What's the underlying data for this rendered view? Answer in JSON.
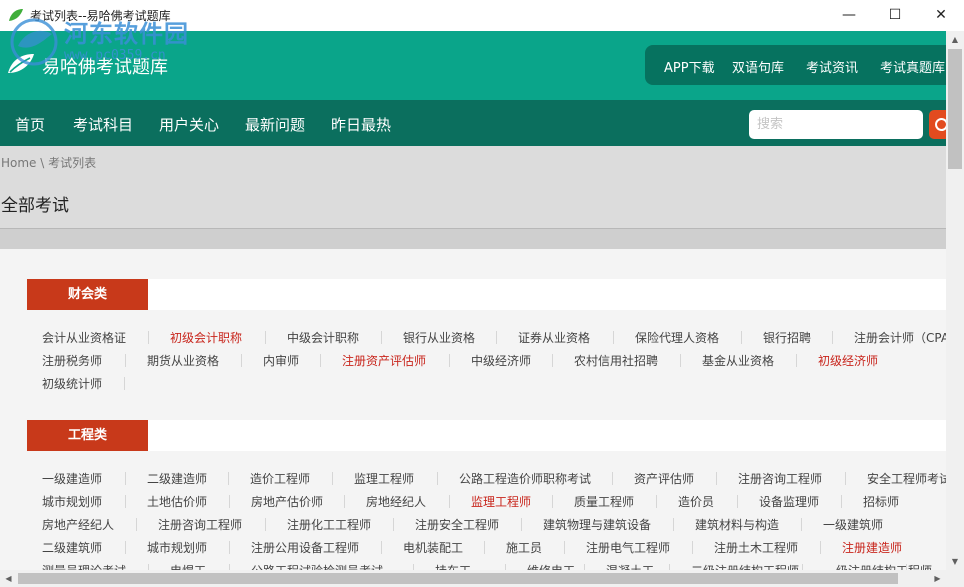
{
  "window": {
    "title": "考试列表--易哈佛考试题库",
    "minimize": "—",
    "maximize": "☐",
    "close": "✕"
  },
  "watermark": {
    "text": "河东软件园",
    "url": "www.pc0359.cn"
  },
  "header": {
    "site_name": "易哈佛考试题库",
    "top_links": [
      "APP下载",
      "双语句库",
      "考试资讯",
      "考试真题库"
    ]
  },
  "nav": {
    "items": [
      "首页",
      "考试科目",
      "用户关心",
      "最新问题",
      "昨日最热"
    ],
    "search_placeholder": "搜索"
  },
  "breadcrumb": "Home \\ 考试列表",
  "page_title": "全部考试",
  "colors": {
    "header": "#0aa58a",
    "nav": "#0b6f5e",
    "category": "#c8391a",
    "highlight_text": "#c8251c"
  },
  "categories": [
    {
      "label": "财会类",
      "rows": [
        [
          {
            "name": "会计从业资格证",
            "hot": false
          },
          {
            "name": "初级会计职称",
            "hot": true
          },
          {
            "name": "中级会计职称",
            "hot": false
          },
          {
            "name": "银行从业资格",
            "hot": false
          },
          {
            "name": "证券从业资格",
            "hot": false
          },
          {
            "name": "保险代理人资格",
            "hot": false
          },
          {
            "name": "银行招聘",
            "hot": false
          },
          {
            "name": "注册会计师（CPA）",
            "hot": false
          }
        ],
        [
          {
            "name": "注册税务师",
            "hot": false
          },
          {
            "name": "期货从业资格",
            "hot": false
          },
          {
            "name": "内审师",
            "hot": false
          },
          {
            "name": "注册资产评估师",
            "hot": true
          },
          {
            "name": "中级经济师",
            "hot": false
          },
          {
            "name": "农村信用社招聘",
            "hot": false
          },
          {
            "name": "基金从业资格",
            "hot": false
          },
          {
            "name": "初级经济师",
            "hot": true
          }
        ],
        [
          {
            "name": "初级统计师",
            "hot": false
          }
        ]
      ]
    },
    {
      "label": "工程类",
      "rows": [
        [
          {
            "name": "一级建造师",
            "hot": false
          },
          {
            "name": "二级建造师",
            "hot": false
          },
          {
            "name": "造价工程师",
            "hot": false
          },
          {
            "name": "监理工程师",
            "hot": false
          },
          {
            "name": "公路工程造价师职称考试",
            "hot": false
          },
          {
            "name": "资产评估师",
            "hot": false
          },
          {
            "name": "注册咨询工程师",
            "hot": false
          },
          {
            "name": "安全工程师考试",
            "hot": false
          }
        ],
        [
          {
            "name": "城市规划师",
            "hot": false
          },
          {
            "name": "土地估价师",
            "hot": false
          },
          {
            "name": "房地产估价师",
            "hot": false
          },
          {
            "name": "房地经纪人",
            "hot": false
          },
          {
            "name": "监理工程师",
            "hot": true
          },
          {
            "name": "质量工程师",
            "hot": false
          },
          {
            "name": "造价员",
            "hot": false
          },
          {
            "name": "设备监理师",
            "hot": false
          },
          {
            "name": "招标师",
            "hot": false
          }
        ],
        [
          {
            "name": "房地产经纪人",
            "hot": false
          },
          {
            "name": "注册咨询工程师",
            "hot": false
          },
          {
            "name": "注册化工工程师",
            "hot": false
          },
          {
            "name": "注册安全工程师",
            "hot": false
          },
          {
            "name": "建筑物理与建筑设备",
            "hot": false
          },
          {
            "name": "建筑材料与构造",
            "hot": false
          },
          {
            "name": "一级建筑师",
            "hot": false
          }
        ],
        [
          {
            "name": "二级建筑师",
            "hot": false
          },
          {
            "name": "城市规划师",
            "hot": false
          },
          {
            "name": "注册公用设备工程师",
            "hot": false
          },
          {
            "name": "电机装配工",
            "hot": false
          },
          {
            "name": "施工员",
            "hot": false
          },
          {
            "name": "注册电气工程师",
            "hot": false
          },
          {
            "name": "注册土木工程师",
            "hot": false
          },
          {
            "name": "注册建造师",
            "hot": true
          }
        ],
        [
          {
            "name": "测量员理论考试",
            "hot": false
          },
          {
            "name": "电焊工",
            "hot": false
          },
          {
            "name": "公路工程试验检测员考试",
            "hot": false
          },
          {
            "name": "挂车工",
            "hot": false
          },
          {
            "name": "维修电工",
            "hot": false
          },
          {
            "name": "混凝土工",
            "hot": false
          },
          {
            "name": "二级注册结构工程师",
            "hot": false
          },
          {
            "name": "一级注册结构工程师",
            "hot": false
          }
        ]
      ]
    }
  ]
}
